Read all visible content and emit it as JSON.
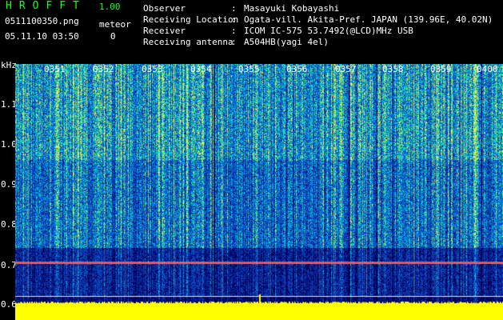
{
  "app": {
    "name": "HROFFT",
    "version": "1.00",
    "filename": "0511100350.png",
    "datetime": "05.11.10 03:50",
    "meteor_label": "meteor",
    "meteor_count": "0"
  },
  "info": {
    "observer_label": "Observer",
    "observer_value": "Masayuki Kobayashi",
    "location_label": "Receiving Location",
    "location_value": "Ogata-vill. Akita-Pref. JAPAN (139.96E, 40.02N)",
    "receiver_label": "Receiver",
    "receiver_value": "ICOM IC-575 53.7492(@LCD)MHz USB",
    "antenna_label": "Receiving antenna",
    "antenna_value": "A504HB(yagi 4el)",
    "separator": ":"
  },
  "axis": {
    "unit": "kHz",
    "freq_labels": [
      "1.1",
      "1.0",
      "0.9",
      "0.8",
      "0.7",
      "0.6"
    ],
    "time_labels": [
      "0351",
      "0352",
      "0353",
      "0354",
      "0355",
      "0356",
      "0357",
      "0358",
      "0359",
      "0400"
    ]
  },
  "colors": {
    "app_title": "#19ff19",
    "band_yellow": "#ffff00",
    "carrier": "#ff5050",
    "grid": "#7a7a7a"
  }
}
